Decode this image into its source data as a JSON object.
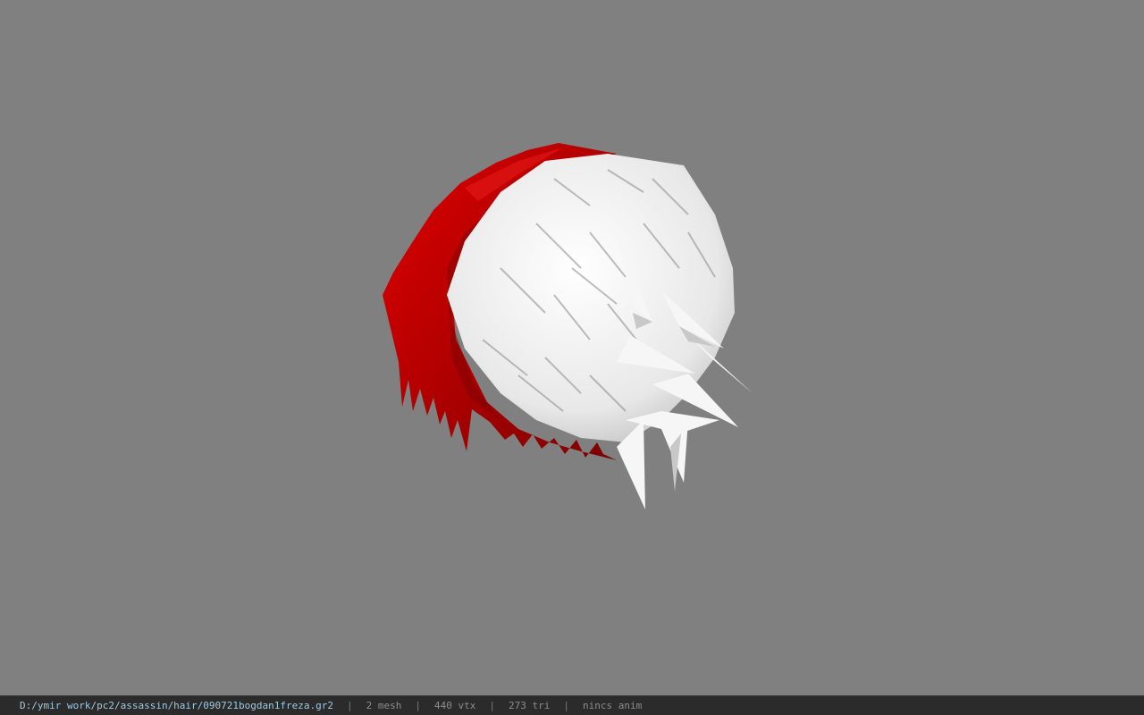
{
  "viewport": {
    "background_color": "#808080",
    "hair_red_color": "#c40000",
    "hair_white_color": "#efefef"
  },
  "status_bar": {
    "file_path": "D:/ymir work/pc2/assassin/hair/090721bogdan1freza.gr2",
    "separator": "|",
    "mesh": "2 mesh",
    "vertices": "440 vtx",
    "triangles": "273 tri",
    "animation": "nincs anim"
  }
}
